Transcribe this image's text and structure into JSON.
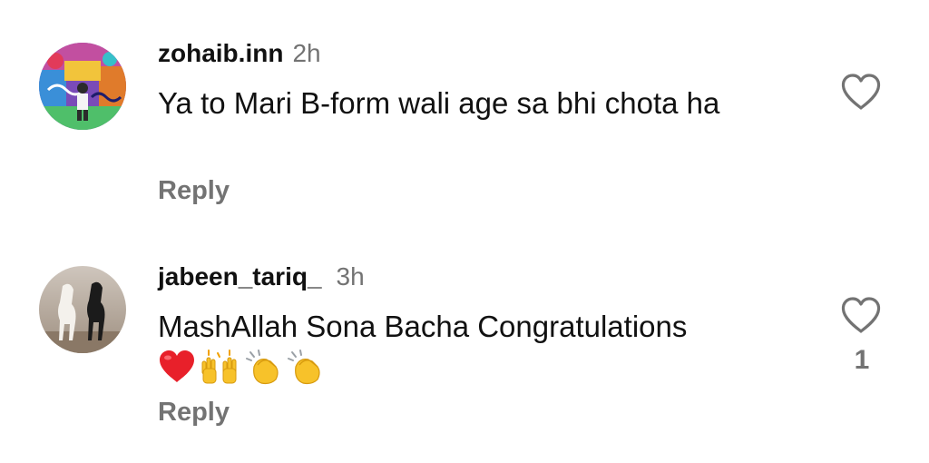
{
  "comments": [
    {
      "username": "zohaib.inn",
      "time": "2h",
      "text": "Ya to Mari B-form wali age sa bhi chota ha",
      "reply_label": "Reply",
      "like_count": "",
      "avatar_icon": "avatar-graffiti-icon"
    },
    {
      "username": "jabeen_tariq_",
      "time": "3h",
      "text": "MashAllah Sona Bacha Congratulations",
      "emojis": [
        "red-heart",
        "raising-hands",
        "clapping-hands",
        "clapping-hands"
      ],
      "reply_label": "Reply",
      "like_count": "1",
      "avatar_icon": "avatar-horses-icon"
    }
  ],
  "colors": {
    "text": "#111111",
    "muted": "#737373",
    "heart_outline": "#737373",
    "background": "#ffffff"
  }
}
